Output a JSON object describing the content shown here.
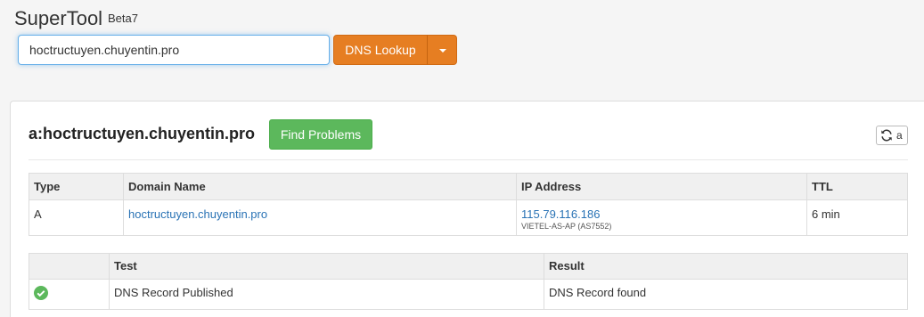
{
  "app": {
    "title": "SuperTool",
    "subtitle": "Beta7"
  },
  "search": {
    "value": "hoctructuyen.chuyentin.pro",
    "button_label": "DNS Lookup"
  },
  "result": {
    "title": "a:hoctructuyen.chuyentin.pro",
    "find_button": "Find Problems",
    "refresh_label": "a"
  },
  "records_table": {
    "headers": [
      "Type",
      "Domain Name",
      "IP Address",
      "TTL"
    ],
    "rows": [
      {
        "type": "A",
        "domain": "hoctructuyen.chuyentin.pro",
        "ip": "115.79.116.186",
        "asn": "VIETEL-AS-AP (AS7552)",
        "ttl": "6 min"
      }
    ]
  },
  "tests_table": {
    "headers": [
      "",
      "Test",
      "Result"
    ],
    "rows": [
      {
        "status": "pass",
        "test": "DNS Record Published",
        "result": "DNS Record found"
      }
    ]
  },
  "colors": {
    "accent_orange": "#e67e22",
    "success_green": "#5cb85c",
    "link_blue": "#2a73b5"
  }
}
